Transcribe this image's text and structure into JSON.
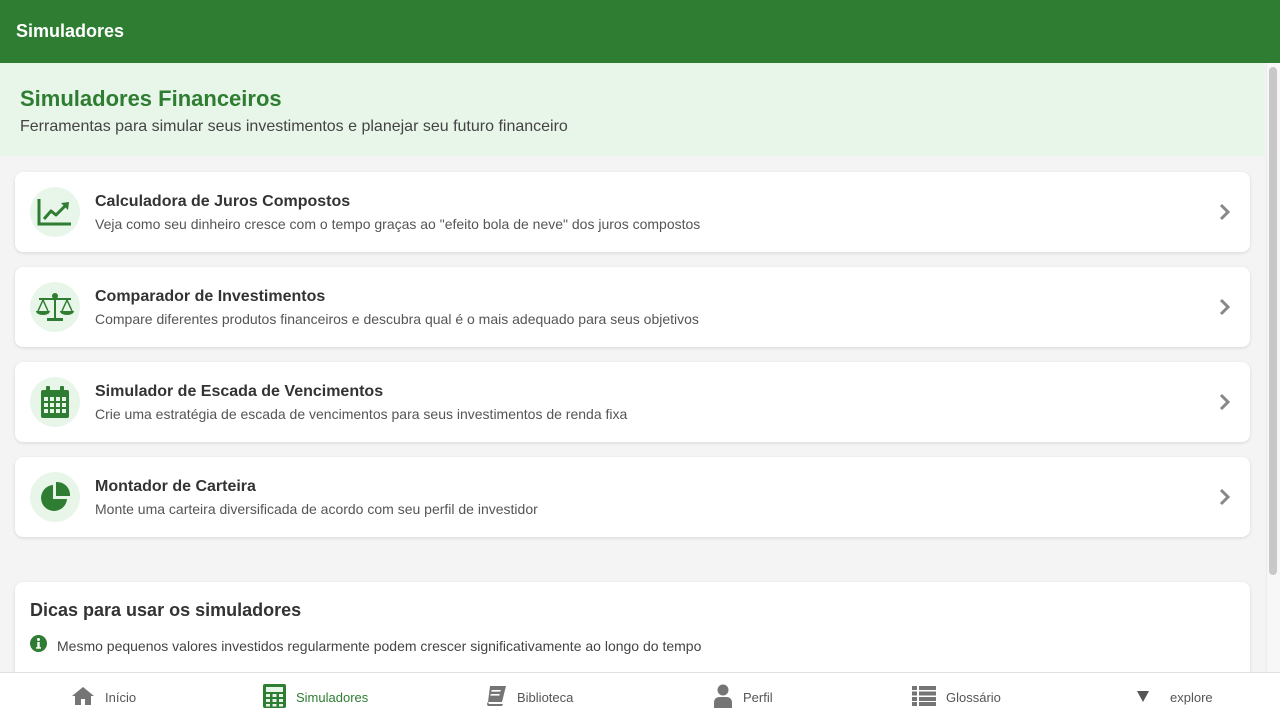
{
  "appbar": {
    "title": "Simuladores"
  },
  "hero": {
    "title": "Simuladores Financeiros",
    "subtitle": "Ferramentas para simular seus investimentos e planejar seu futuro financeiro"
  },
  "simulators": [
    {
      "icon": "chart-line-icon",
      "title": "Calculadora de Juros Compostos",
      "description": "Veja como seu dinheiro cresce com o tempo graças ao \"efeito bola de neve\" dos juros compostos"
    },
    {
      "icon": "balance-scale-icon",
      "title": "Comparador de Investimentos",
      "description": "Compare diferentes produtos financeiros e descubra qual é o mais adequado para seus objetivos"
    },
    {
      "icon": "calendar-icon",
      "title": "Simulador de Escada de Vencimentos",
      "description": "Crie uma estratégia de escada de vencimentos para seus investimentos de renda fixa"
    },
    {
      "icon": "pie-chart-icon",
      "title": "Montador de Carteira",
      "description": "Monte uma carteira diversificada de acordo com seu perfil de investidor"
    }
  ],
  "tips": {
    "title": "Dicas para usar os simuladores",
    "items": [
      "Mesmo pequenos valores investidos regularmente podem crescer significativamente ao longo do tempo"
    ]
  },
  "bottom_nav": {
    "items": [
      {
        "label": "Início",
        "icon": "home-icon",
        "active": false
      },
      {
        "label": "Simuladores",
        "icon": "calculator-icon",
        "active": true
      },
      {
        "label": "Biblioteca",
        "icon": "book-icon",
        "active": false
      },
      {
        "label": "Perfil",
        "icon": "user-icon",
        "active": false
      },
      {
        "label": "Glossário",
        "icon": "list-icon",
        "active": false
      },
      {
        "label": "explore",
        "icon": "triangle-down-icon",
        "active": false
      }
    ]
  },
  "colors": {
    "primary": "#2e7d32",
    "hero_background": "#e8f5e9",
    "inactive_icon": "#757575"
  }
}
